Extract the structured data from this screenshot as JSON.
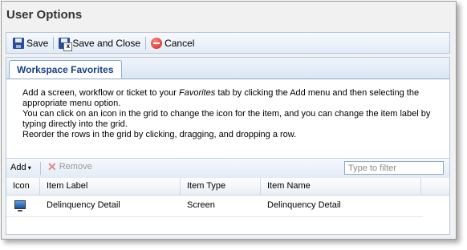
{
  "window": {
    "title": "User Options"
  },
  "toolbar": {
    "save_label": "Save",
    "save_close_label": "Save and Close",
    "cancel_label": "Cancel"
  },
  "tabs": [
    {
      "label": "Workspace Favorites",
      "active": true
    }
  ],
  "instructions": {
    "p1_before": "Add a screen, workflow or ticket to your ",
    "p1_em": "Favorites",
    "p1_after": " tab by clicking the Add menu and then selecting the appropriate menu option.",
    "p2": "You can click on an icon in the grid to change the icon for the item, and you can change the item label by typing directly into the grid.",
    "p3": "Reorder the rows in the grid by clicking, dragging, and dropping a row."
  },
  "grid_toolbar": {
    "add_label": "Add",
    "remove_label": "Remove",
    "filter_placeholder": "Type to filter",
    "filter_value": ""
  },
  "grid": {
    "columns": [
      "Icon",
      "Item Label",
      "Item Type",
      "Item Name"
    ],
    "rows": [
      {
        "icon": "monitor-icon",
        "label": "Delinquency Detail",
        "type": "Screen",
        "name": "Delinquency Detail"
      }
    ]
  }
}
